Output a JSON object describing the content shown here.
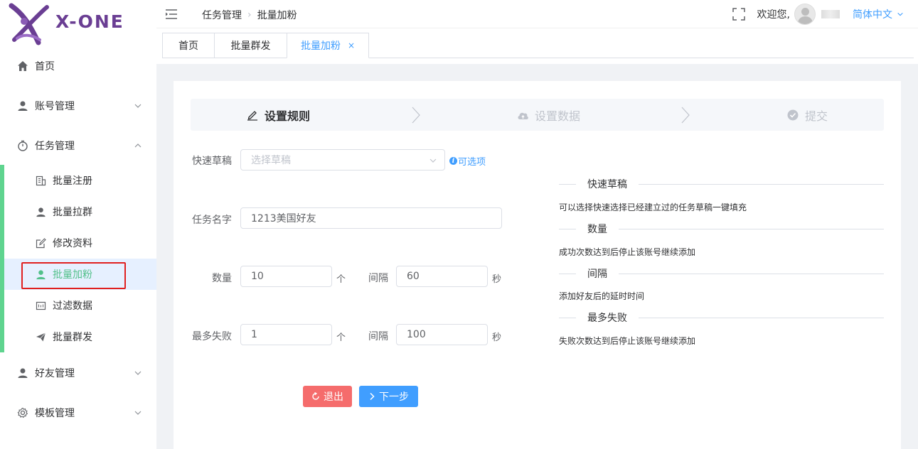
{
  "logo": {
    "text": "X-ONE"
  },
  "sidebar": {
    "menu": [
      {
        "label": "首页",
        "icon": "home-icon"
      },
      {
        "label": "账号管理",
        "icon": "user-icon"
      },
      {
        "label": "任务管理",
        "icon": "timer-icon"
      },
      {
        "label": "好友管理",
        "icon": "user-icon"
      },
      {
        "label": "模板管理",
        "icon": "gear-icon"
      }
    ],
    "submenu": [
      {
        "label": "批量注册",
        "icon": "office-icon"
      },
      {
        "label": "批量拉群",
        "icon": "user-icon"
      },
      {
        "label": "修改资料",
        "icon": "edit-icon"
      },
      {
        "label": "批量加粉",
        "icon": "user-icon",
        "active": true
      },
      {
        "label": "过滤数据",
        "icon": "filter-data-icon"
      },
      {
        "label": "批量群发",
        "icon": "send-icon"
      }
    ],
    "accent_color": "#52c08a"
  },
  "header": {
    "breadcrumb": [
      "任务管理",
      "批量加粉"
    ],
    "welcome": "欢迎您,",
    "language": "简体中文"
  },
  "tabs": [
    {
      "label": "首页"
    },
    {
      "label": "批量群发"
    },
    {
      "label": "批量加粉",
      "active": true,
      "close": "×"
    }
  ],
  "steps": [
    {
      "label": "设置规则",
      "state": "active",
      "icon": "edit-icon"
    },
    {
      "label": "设置数据",
      "state": "inactive",
      "icon": "cloud-upload-icon"
    },
    {
      "label": "提交",
      "state": "inactive",
      "icon": "check-circle-icon"
    }
  ],
  "form": {
    "draft_label": "快速草稿",
    "draft_placeholder": "选择草稿",
    "draft_optional": "可选项",
    "task_name_label": "任务名字",
    "task_name_value": "1213美国好友",
    "quantity_label": "数量",
    "quantity_value": "10",
    "quantity_unit": "个",
    "interval_label": "间隔",
    "interval_value": "60",
    "interval_unit": "秒",
    "max_fail_label": "最多失败",
    "max_fail_value": "1",
    "max_fail_unit": "个",
    "interval2_label": "间隔",
    "interval2_value": "100",
    "interval2_unit": "秒"
  },
  "help": [
    {
      "title": "快速草稿",
      "text": "可以选择快速选择已经建立过的任务草稿一键填充"
    },
    {
      "title": "数量",
      "text": "成功次数达到后停止该账号继续添加"
    },
    {
      "title": "间隔",
      "text": "添加好友后的延时时间"
    },
    {
      "title": "最多失败",
      "text": "失败次数达到后停止该账号继续添加"
    }
  ],
  "buttons": {
    "exit": "退出",
    "next": "下一步"
  },
  "colors": {
    "primary": "#409eff",
    "danger": "#f56c6c",
    "logo": "#6a3e93"
  }
}
